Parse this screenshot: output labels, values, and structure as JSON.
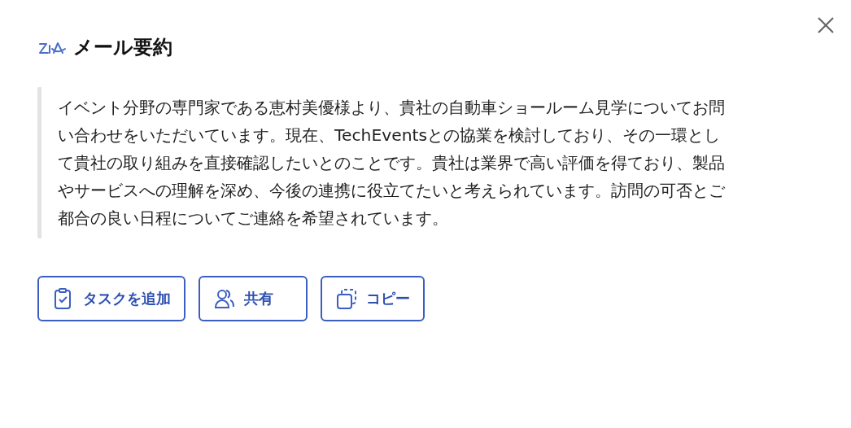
{
  "title": "メール要約",
  "summary": "イベント分野の専門家である恵村美優様より、貴社の自動車ショールーム見学についてお問い合わせをいただいています。現在、TechEventsとの協業を検討しており、その一環として貴社の取り組みを直接確認したいとのことです。貴社は業界で高い評価を得ており、製品やサービスへの理解を深め、今後の連携に役立てたいと考えられています。訪問の可否とご都合の良い日程についてご連絡を希望されています。",
  "buttons": [
    {
      "label": "タスクを追加",
      "kind": "task"
    },
    {
      "label": "共有",
      "kind": "share"
    },
    {
      "label": "コピー",
      "kind": "copy"
    }
  ]
}
